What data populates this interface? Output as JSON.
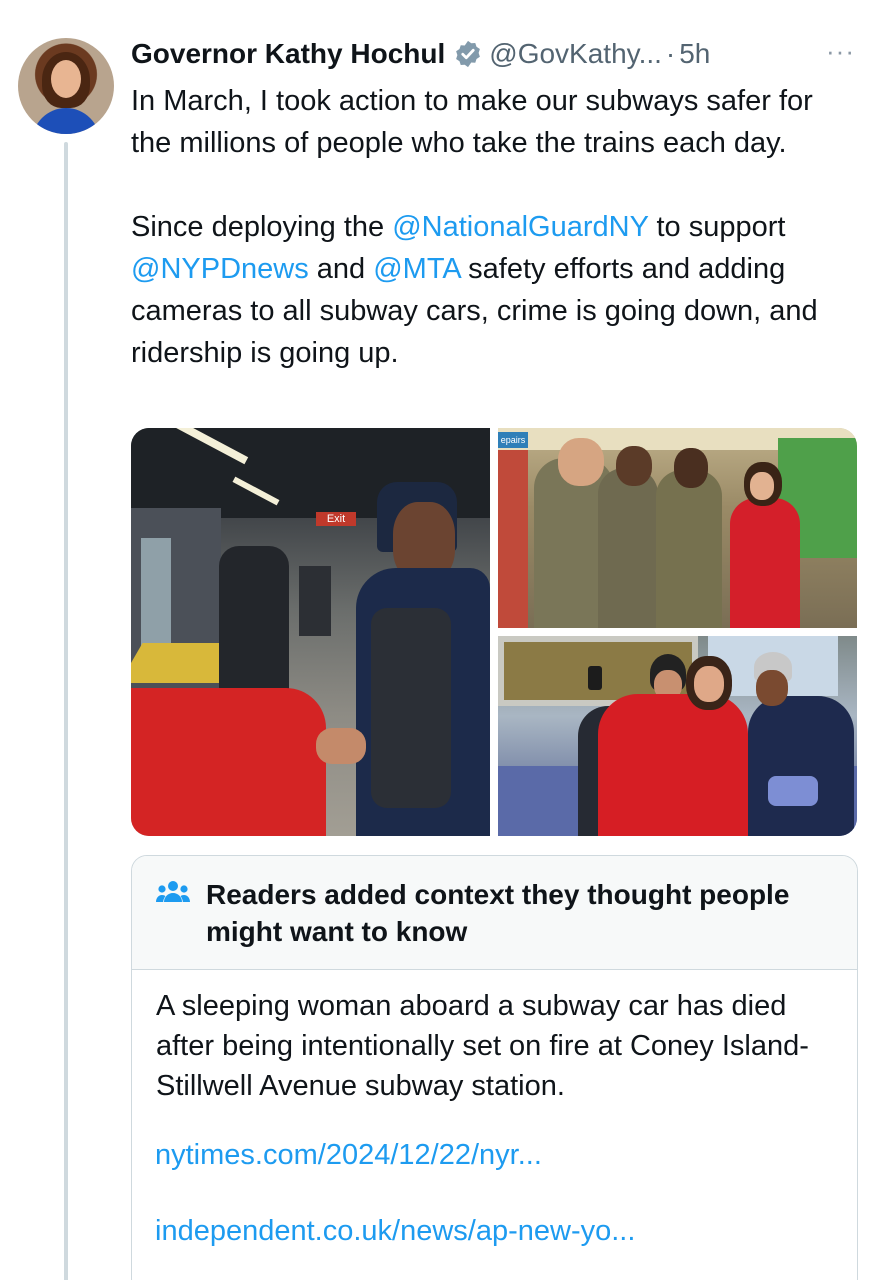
{
  "tweet": {
    "author_name": "Governor Kathy Hochul",
    "handle": "@GovKathy...",
    "separator": "·",
    "time": "5h",
    "more_label": "···",
    "text_line1": "In March, I took action to make our subways safer for the millions of people who take the trains each day.",
    "text_p2_before": "Since deploying the ",
    "mention1": "@NationalGuardNY",
    "text_p2_mid1": " to support ",
    "mention2": "@NYPDnews",
    "text_p2_mid2": " and ",
    "mention3": "@MTA",
    "text_p2_after": " safety efforts and adding cameras to all subway cars, crime is going down, and ridership is going up."
  },
  "media": {
    "photo1_sign": "Exit",
    "photo2_sign": "epairs"
  },
  "community_note": {
    "title": "Readers added context they thought people might want to know",
    "body": "A sleeping woman aboard a subway car has died after being intentionally set on fire at Coney Island-Stillwell Avenue subway station.",
    "link1": "nytimes.com/2024/12/22/nyr...",
    "link2": "independent.co.uk/news/ap-new-yo..."
  },
  "colors": {
    "link": "#1d9bf0",
    "secondary_text": "#536471",
    "border": "#cfd9de",
    "verified_badge": "#829aab"
  },
  "icons": {
    "verified": "verified-badge-icon",
    "more": "more-options-icon",
    "note": "community-notes-icon"
  }
}
